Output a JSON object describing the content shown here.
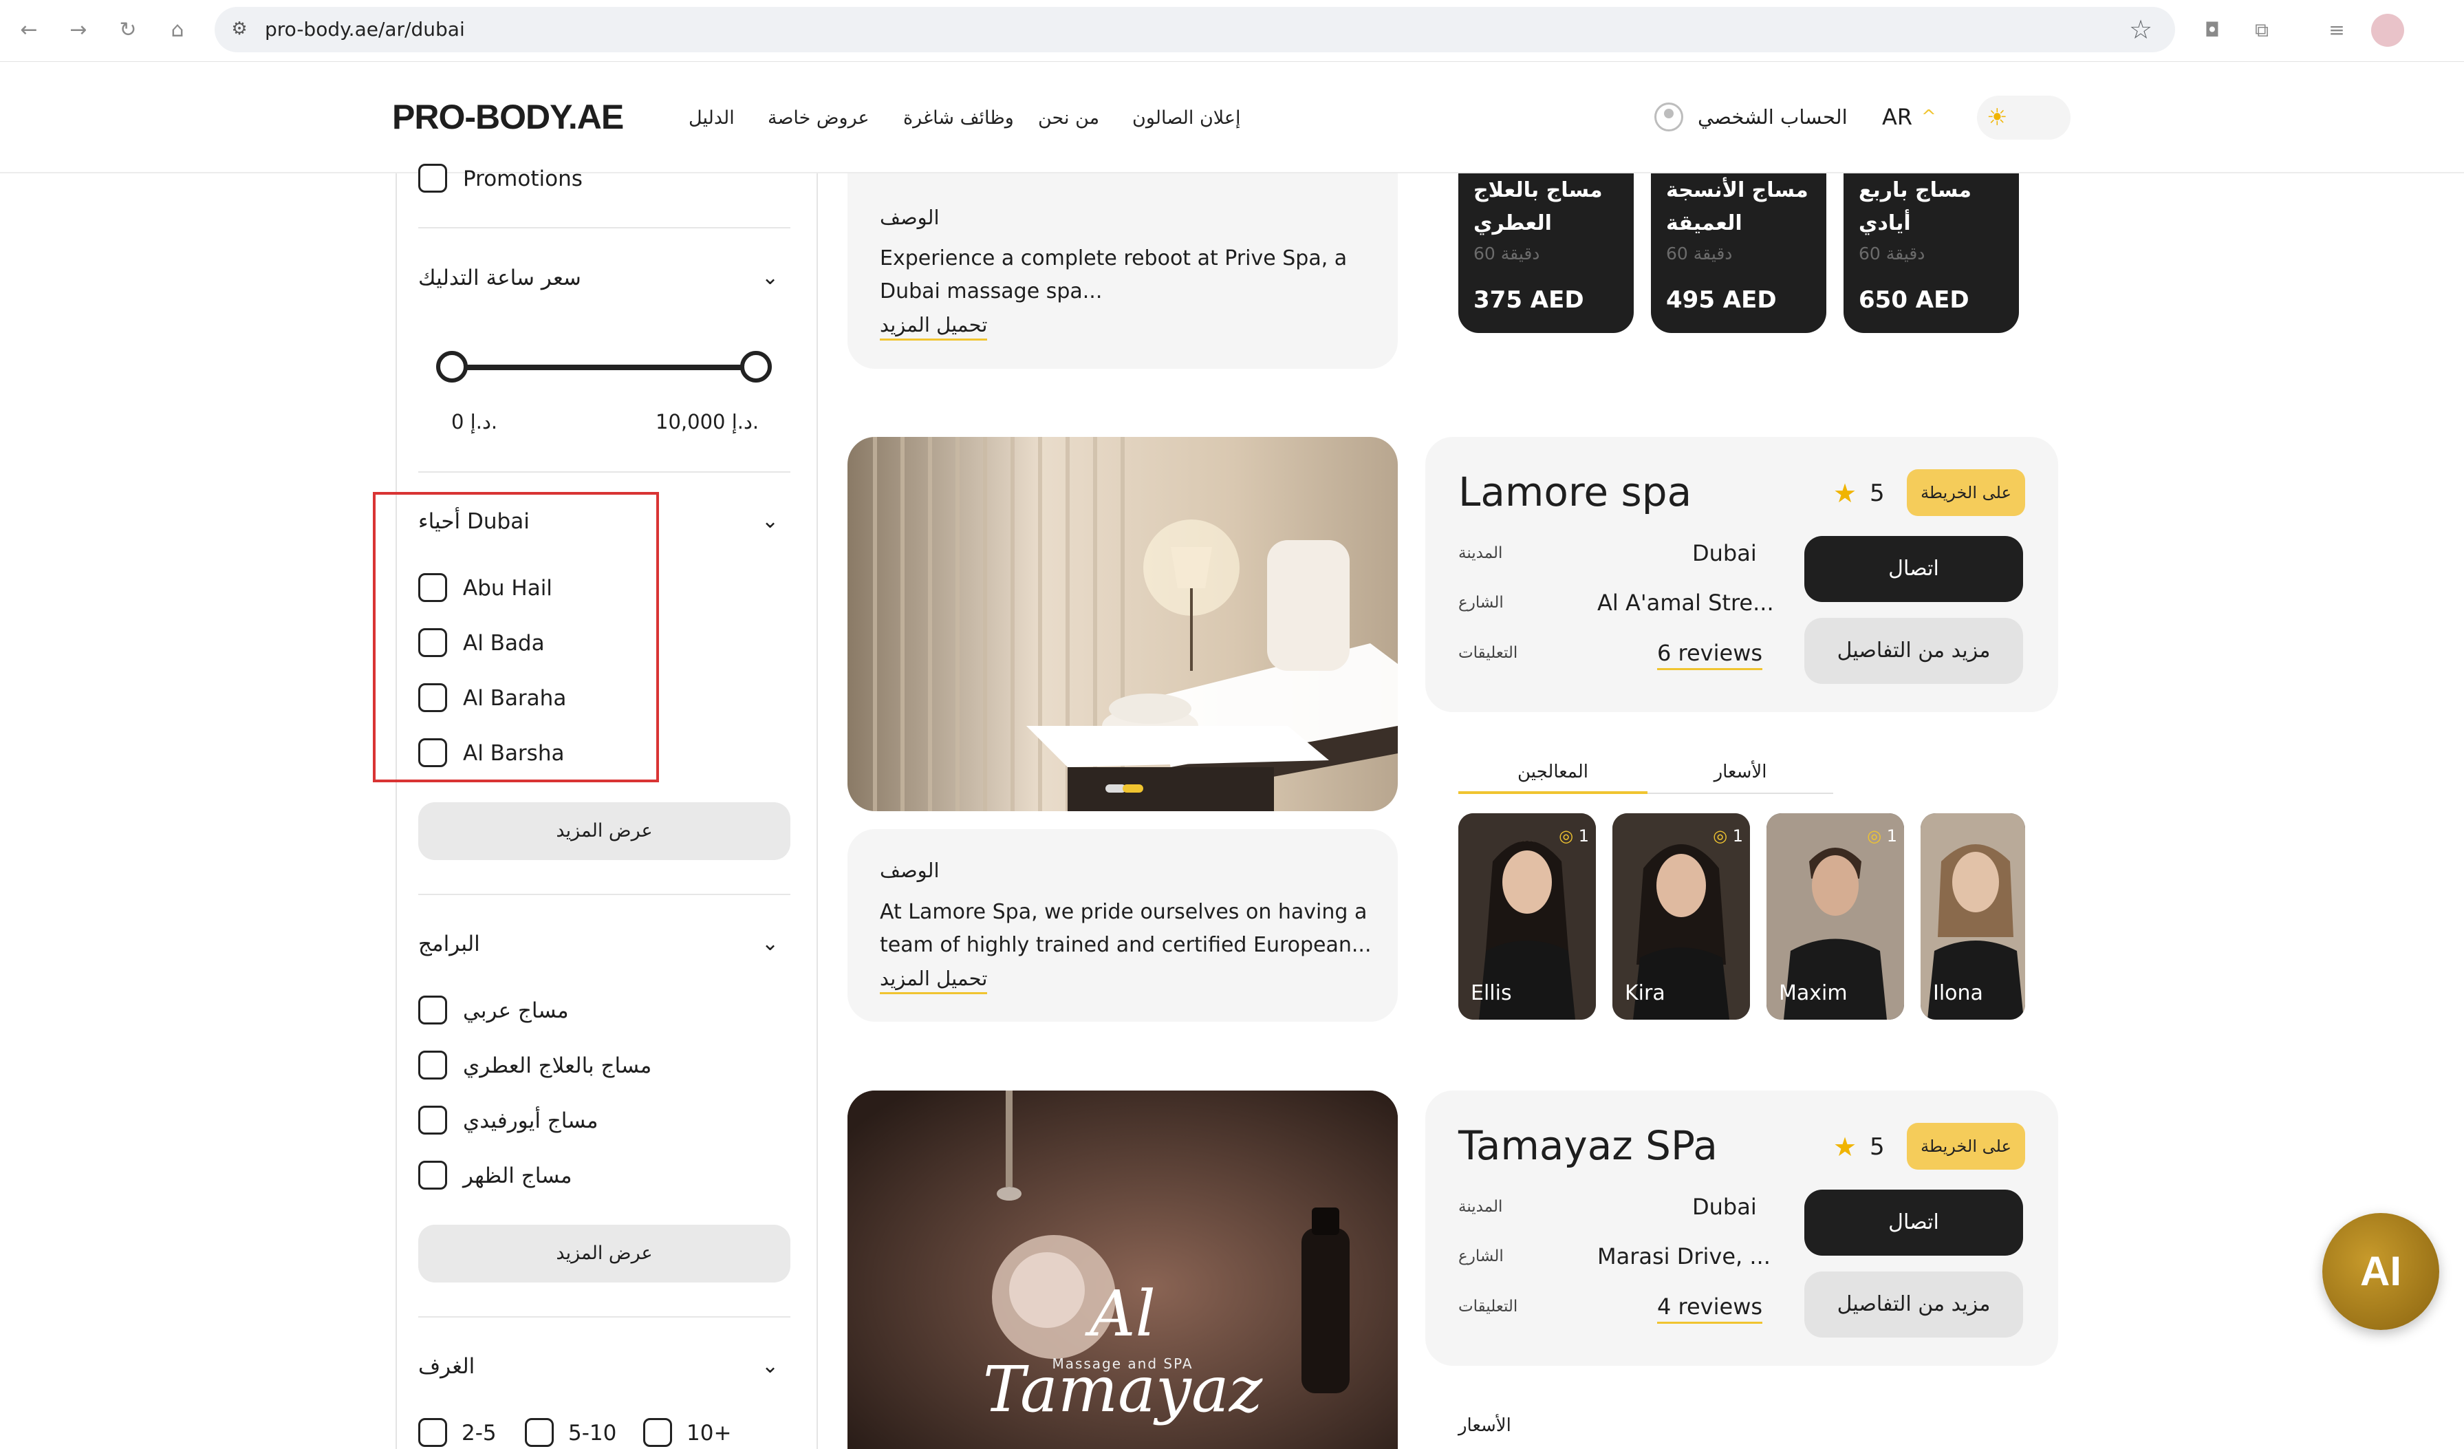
{
  "browser": {
    "url": "pro-body.ae/ar/dubai"
  },
  "header": {
    "logo": "PRO-BODY.AE",
    "menu": [
      "الدليل",
      "عروض خاصة",
      "وظائف شاغرة",
      "من نحن",
      "إعلان الصالون"
    ],
    "account": "الحساب الشخصي",
    "language": "AR"
  },
  "sidebar": {
    "promotions_label": "Promotions",
    "price": {
      "title": "سعر ساعة التدليك",
      "min_label": "0 د.إ.",
      "max_label": "10,000 د.إ."
    },
    "districts": {
      "title": "أحياء Dubai",
      "items": [
        "Abu Hail",
        "Al Bada",
        "Al Baraha",
        "Al Barsha"
      ],
      "more": "عرض المزيد"
    },
    "programs": {
      "title": "البرامج",
      "items": [
        "مساج عربي",
        "مساج بالعلاج العطري",
        "مساج أيورفيدي",
        "مساج الظهر"
      ],
      "more": "عرض المزيد"
    },
    "rooms": {
      "title": "الغرف",
      "items": [
        "2-5",
        "5-10",
        "10+"
      ]
    }
  },
  "prive_spa": {
    "desc_title": "الوصف",
    "desc_text_1": "Experience a complete reboot at Prive Spa, a",
    "desc_text_2": "Dubai massage spa...",
    "load_more": "تحميل المزيد",
    "prices": [
      {
        "title_1": "مساج بالعلاج",
        "title_2": "العطري",
        "duration": "60 دقيقة",
        "price": "375 AED"
      },
      {
        "title_1": "مساج الأنسجة",
        "title_2": "العميقة",
        "duration": "60 دقيقة",
        "price": "495 AED"
      },
      {
        "title_1": "مساج باربع",
        "title_2": "أيادي",
        "duration": "60 دقيقة",
        "price": "650 AED"
      }
    ]
  },
  "lamore": {
    "name": "Lamore spa",
    "rating": "5",
    "map_button": "على الخريطة",
    "call_button": "اتصال",
    "details_button": "مزيد من التفاصيل",
    "city_key": "المدينة",
    "city": "Dubai",
    "street_key": "الشارع",
    "street": "Al A'amal Stre...",
    "reviews_key": "التعليقات",
    "reviews": "6 reviews",
    "tab_therapists": "المعالجين",
    "tab_prices": "الأسعار",
    "desc_title": "الوصف",
    "desc_text_1": "At Lamore Spa, we pride ourselves on having a",
    "desc_text_2": "team of highly trained and certified European...",
    "load_more": "تحميل المزيد",
    "therapists": [
      {
        "name": "Ellis",
        "count": "1"
      },
      {
        "name": "Kira",
        "count": "1"
      },
      {
        "name": "Maxim",
        "count": "1"
      },
      {
        "name": "Ilona",
        "count": ""
      }
    ]
  },
  "tamayaz": {
    "name": "Tamayaz SPa",
    "rating": "5",
    "map_button": "على الخريطة",
    "call_button": "اتصال",
    "details_button": "مزيد من التفاصيل",
    "city_key": "المدينة",
    "city": "Dubai",
    "street_key": "الشارع",
    "street": "Marasi Drive, ...",
    "reviews_key": "التعليقات",
    "reviews": "4 reviews",
    "prices_label": "الأسعار",
    "image_text": "Al Tamayaz",
    "image_subtext": "Massage and SPA"
  },
  "ai_button": "AI",
  "colors": {
    "accent": "#f0c430",
    "dark_card": "#1f1f1f",
    "card_bg": "#f5f5f5",
    "highlight_box": "#d93434"
  }
}
